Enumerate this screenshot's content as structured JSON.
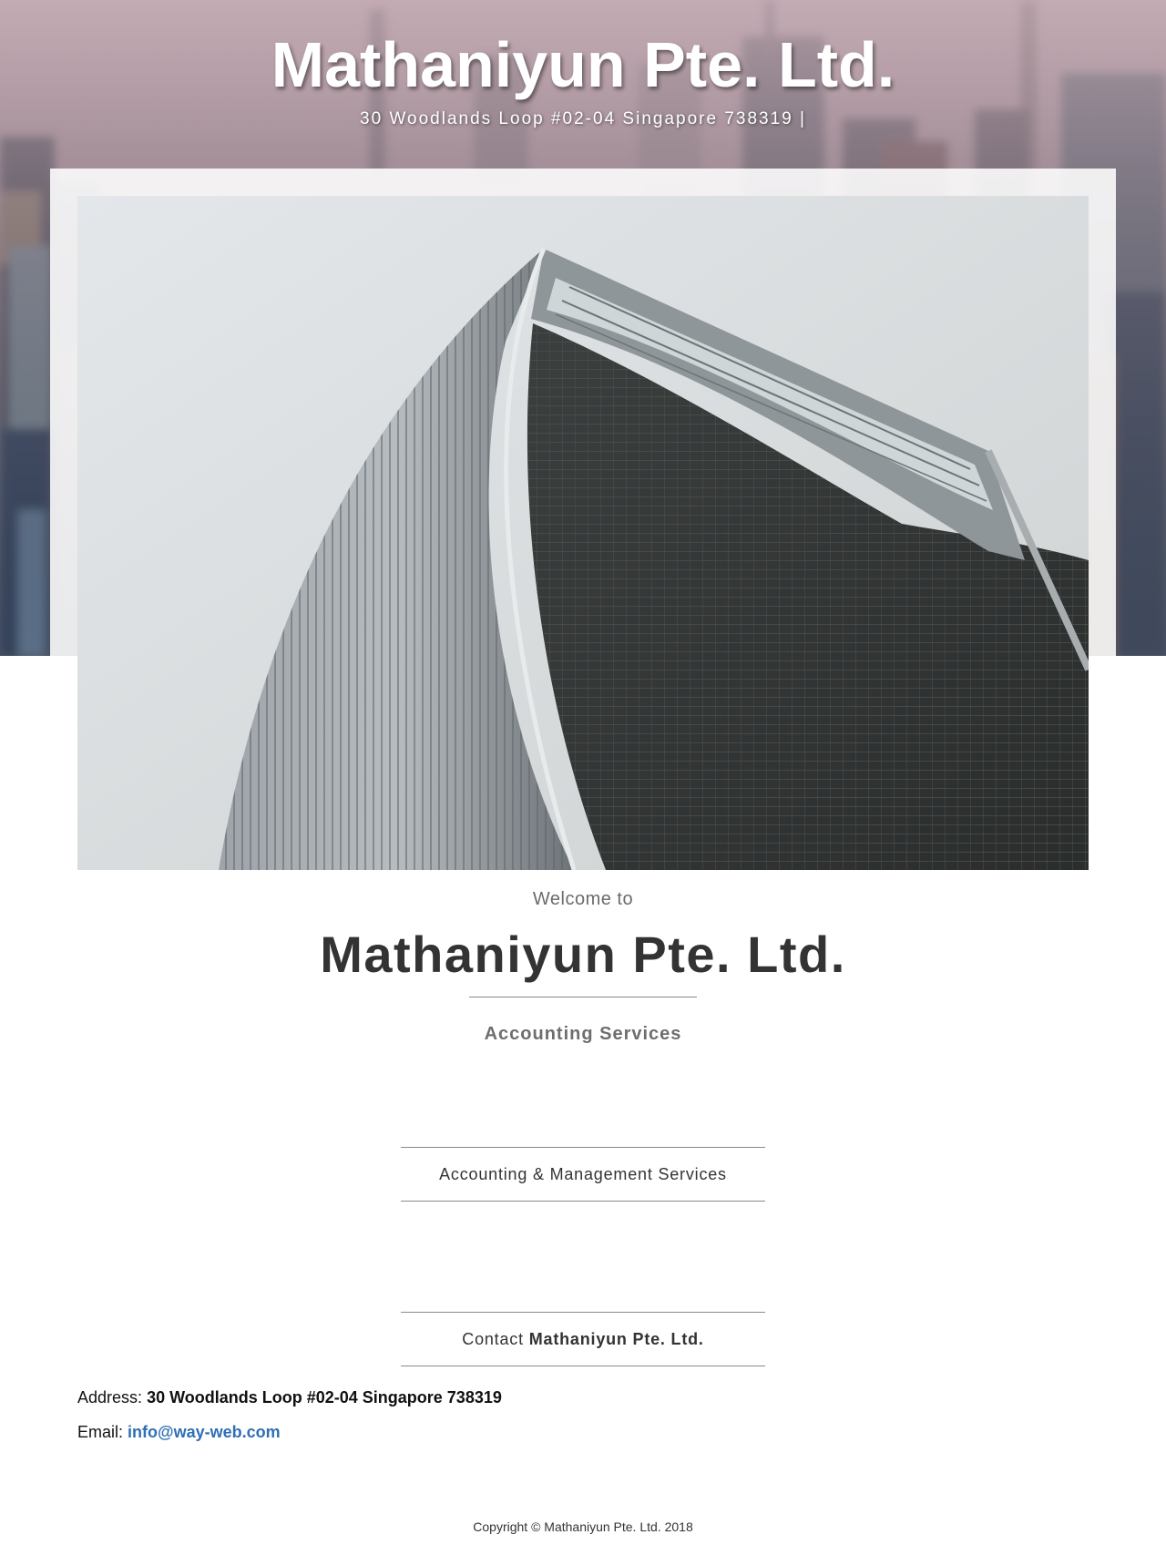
{
  "header": {
    "site_title": "Mathaniyun Pte. Ltd.",
    "address_line": "30 Woodlands Loop #02-04 Singapore 738319 |"
  },
  "hero": {
    "image_subject": "skyscraper-photo"
  },
  "welcome": {
    "intro": "Welcome to",
    "company_name": "Mathaniyun Pte. Ltd.",
    "tagline": "Accounting Services"
  },
  "services": {
    "label": "Accounting & Management Services"
  },
  "contact": {
    "heading_prefix": "Contact",
    "heading_company": "Mathaniyun Pte. Ltd.",
    "address_label": "Address:",
    "address_value": "30 Woodlands Loop #02-04 Singapore 738319",
    "email_label": "Email:",
    "email_value": "info@way-web.com"
  },
  "footer": {
    "copyright": "Copyright © Mathaniyun Pte. Ltd. 2018"
  },
  "colors": {
    "link": "#2f6fb5",
    "heading": "#333333",
    "muted": "#6b6b6b"
  }
}
